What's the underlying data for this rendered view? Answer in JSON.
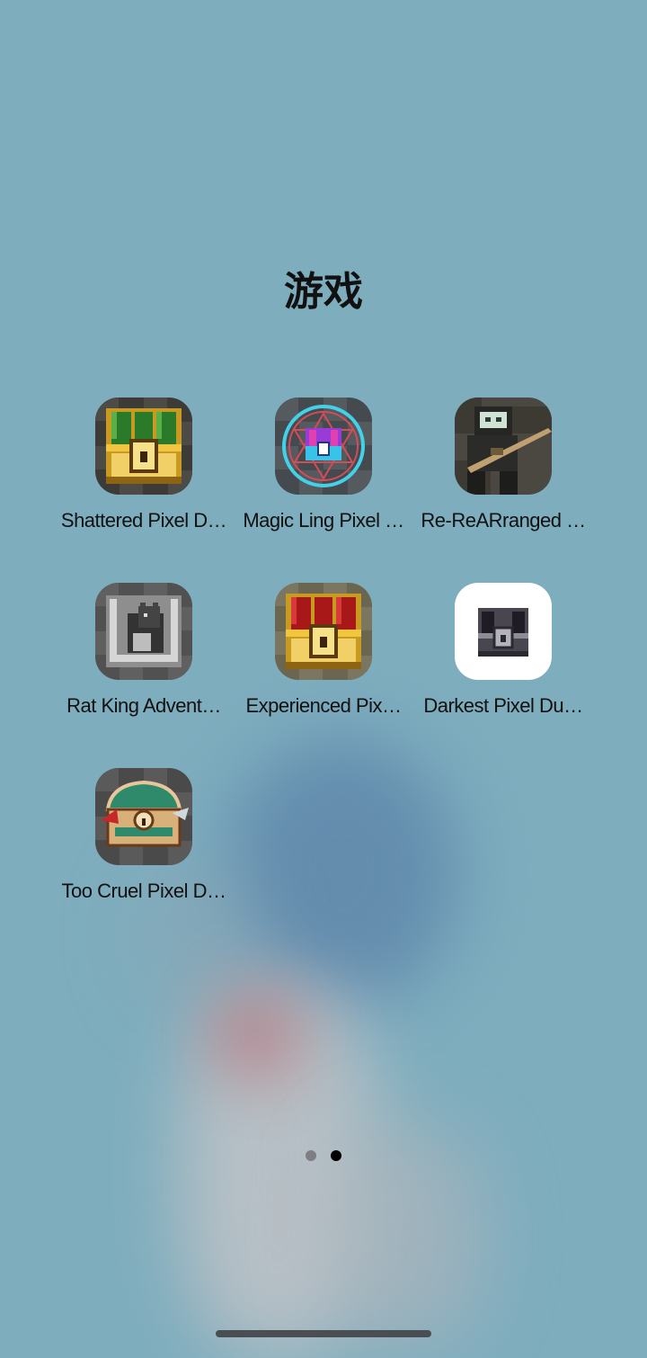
{
  "folder": {
    "title": "游戏"
  },
  "apps": [
    {
      "label": "Shattered Pixel D…",
      "icon": "treasure-chest-green-icon"
    },
    {
      "label": "Magic Ling Pixel …",
      "icon": "magic-circle-chest-icon"
    },
    {
      "label": "Re-ReARranged …",
      "icon": "sniper-soldier-icon"
    },
    {
      "label": "Rat King Advent…",
      "icon": "rat-king-icon"
    },
    {
      "label": "Experienced Pix…",
      "icon": "treasure-chest-red-icon"
    },
    {
      "label": "Darkest Pixel Du…",
      "icon": "dark-chest-icon"
    },
    {
      "label": "Too Cruel Pixel D…",
      "icon": "mimic-chest-icon"
    }
  ],
  "pagination": {
    "pages": 2,
    "current": 2
  }
}
